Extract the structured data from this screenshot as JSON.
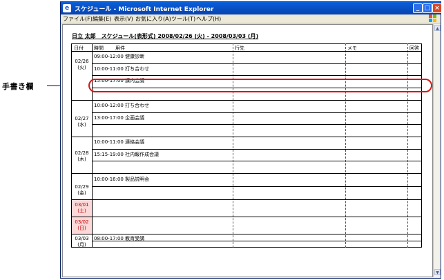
{
  "annotation": {
    "label": "手書き欄"
  },
  "window": {
    "title": "スケジュール - Microsoft Internet Explorer",
    "buttons": {
      "minimize": "_",
      "maximize": "□",
      "close": "×"
    }
  },
  "menu": [
    "ファイル(F)",
    "編集(E)",
    "表示(V)",
    "お気に入り(A)",
    "ツール(T)",
    "ヘルプ(H)"
  ],
  "page": {
    "heading": "日立 太郎　スケジュール(表形式) 2008/02/26 (火) - 2008/03/03 (月)",
    "columns": {
      "date": "日付",
      "time": "時間",
      "subject": "用件",
      "place": "行先",
      "memo": "メモ",
      "reply": "回答"
    },
    "days": [
      {
        "date": "02/26",
        "dow": "(火)",
        "weekend": false,
        "entries": [
          "09:00-12:00 健康診断",
          "10:00-11:00 打ち合わせ",
          "15:00-17:00 課内会議"
        ]
      },
      {
        "date": "02/27",
        "dow": "(水)",
        "weekend": false,
        "entries": [
          "10:00-12:00 打ち合わせ",
          "13:00-17:00 企画会議"
        ]
      },
      {
        "date": "02/28",
        "dow": "(木)",
        "weekend": false,
        "entries": [
          "10:00-11:00 連絡会議",
          "15:15-19:00 社内報作成会議"
        ]
      },
      {
        "date": "02/29",
        "dow": "(金)",
        "weekend": false,
        "entries": [
          "10:00-16:00 製品説明会"
        ]
      },
      {
        "date": "03/01",
        "dow": "(土)",
        "weekend": true,
        "entries": []
      },
      {
        "date": "03/02",
        "dow": "(日)",
        "weekend": true,
        "entries": []
      },
      {
        "date": "03/03",
        "dow": "(月)",
        "weekend": false,
        "entries": [
          "08:00-17:00 教育受講"
        ]
      }
    ]
  }
}
